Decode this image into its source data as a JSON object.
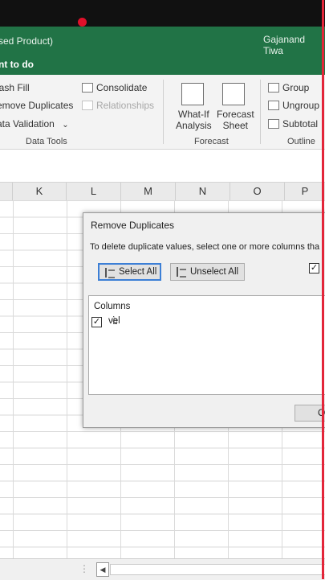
{
  "title_bar": {
    "document": "sed Product)",
    "user": "Gajanand Tiwa"
  },
  "tell_me": "nt to do",
  "ribbon": {
    "data_tools": {
      "flash_fill": "lash Fill",
      "remove_duplicates": "emove Duplicates",
      "data_validation": "ata Validation",
      "dropdown_glyph": "⌄",
      "consolidate": "Consolidate",
      "relationships": "Relationships",
      "group_label": "Data Tools"
    },
    "forecast": {
      "what_if_line1": "What-If",
      "what_if_line2": "Analysis",
      "forecast_sheet_line1": "Forecast",
      "forecast_sheet_line2": "Sheet",
      "group_label": "Forecast"
    },
    "outline": {
      "group": "Group",
      "ungroup": "Ungroup",
      "subtotal": "Subtotal",
      "group_label": "Outline"
    }
  },
  "columns": [
    "K",
    "L",
    "M",
    "N",
    "O",
    "P"
  ],
  "dialog": {
    "title": "Remove Duplicates",
    "instruction": "To delete duplicate values, select one or more columns tha",
    "select_all": "Select All",
    "unselect_all": "Unselect All",
    "columns_label": "Columns",
    "column_item": "vel",
    "ok": "OK",
    "check": "✓"
  },
  "status": {
    "dots": "⋮",
    "scroll_left": "◀"
  }
}
